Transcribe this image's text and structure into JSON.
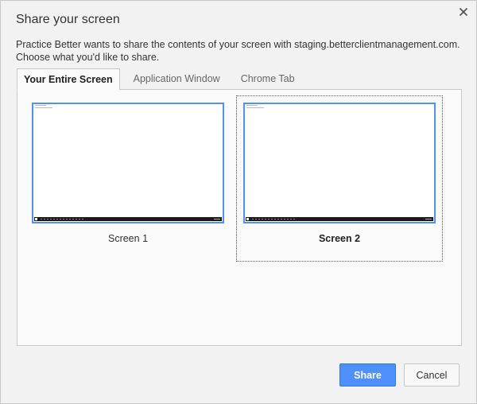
{
  "dialog": {
    "title": "Share your screen",
    "description": "Practice Better wants to share the contents of your screen with staging.betterclientmanagement.com. Choose what you'd like to share.",
    "close_icon": "close-icon"
  },
  "tabs": [
    {
      "label": "Your Entire Screen",
      "active": true
    },
    {
      "label": "Application Window",
      "active": false
    },
    {
      "label": "Chrome Tab",
      "active": false
    }
  ],
  "screens": [
    {
      "label": "Screen 1",
      "selected": false
    },
    {
      "label": "Screen 2",
      "selected": true
    }
  ],
  "buttons": {
    "share_label": "Share",
    "cancel_label": "Cancel"
  },
  "colors": {
    "accent": "#4d90fe",
    "background": "#f2f2f2",
    "panel": "#fafafa"
  }
}
